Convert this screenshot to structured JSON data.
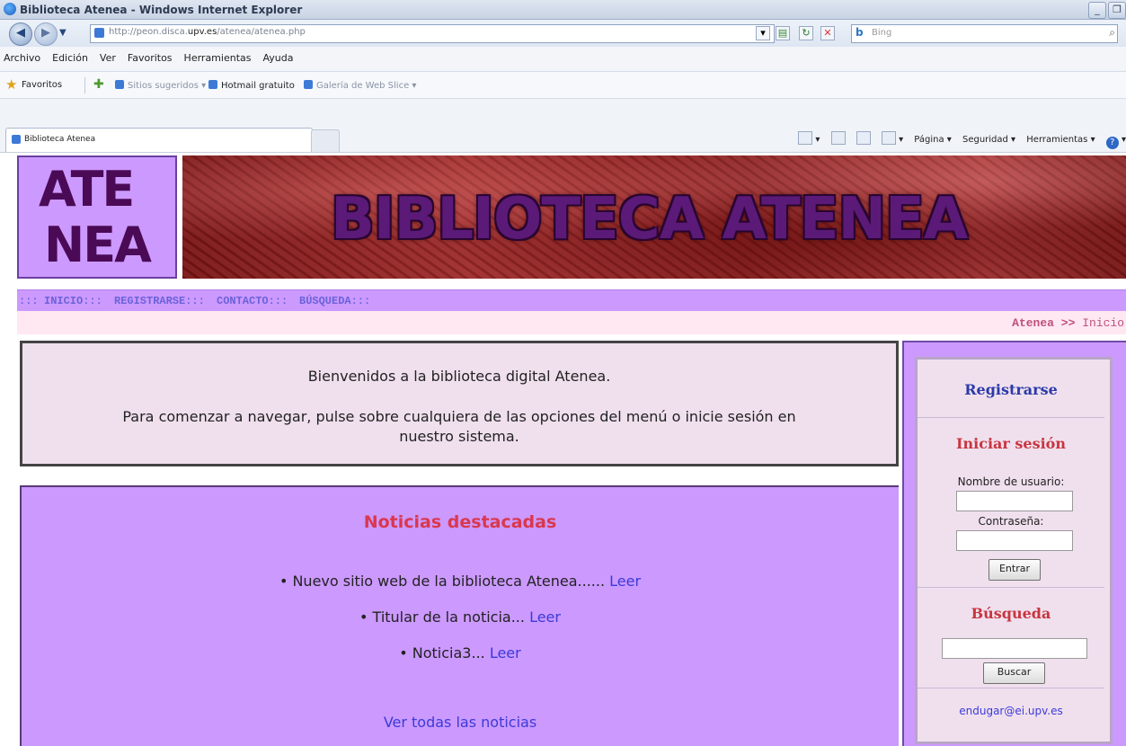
{
  "browser": {
    "window_title": "Biblioteca Atenea - Windows Internet Explorer",
    "url_prefix": "http://",
    "url_host_dim": "peon.disca.",
    "url_host": "upv.es",
    "url_path": "/atenea/atenea.php",
    "search_placeholder": "Bing",
    "menu": [
      "Archivo",
      "Edición",
      "Ver",
      "Favoritos",
      "Herramientas",
      "Ayuda"
    ],
    "favorites_label": "Favoritos",
    "favorites_items": [
      "Sitios sugeridos ▾",
      "Hotmail gratuito",
      "Galería de Web Slice ▾"
    ],
    "tab_label": "Biblioteca Atenea",
    "commands": [
      "Página ▾",
      "Seguridad ▾",
      "Herramientas ▾"
    ]
  },
  "header": {
    "logo_line1": "ATE",
    "logo_line2": "NEA",
    "banner_title": "BIBLIOTECA ATENEA"
  },
  "nav": {
    "prefix": ":::",
    "items": [
      "INICIO:::",
      "REGISTRARSE:::",
      "CONTACTO:::",
      "BÚSQUEDA:::"
    ]
  },
  "breadcrumb": {
    "root": "Atenea",
    "sep": ">>",
    "current": "Inicio"
  },
  "welcome": {
    "line1": "Bienvenidos a la biblioteca digital Atenea.",
    "line2": "Para comenzar a navegar, pulse sobre cualquiera de las opciones del menú o inicie sesión en",
    "line3": "nuestro sistema."
  },
  "news": {
    "title": "Noticias destacadas",
    "items": [
      {
        "text": "• Nuevo sitio web de la biblioteca Atenea......",
        "link": "Leer"
      },
      {
        "text": "• Titular de la noticia...",
        "link": "Leer"
      },
      {
        "text": "• Noticia3...",
        "link": "Leer"
      }
    ],
    "see_all": "Ver todas las noticias"
  },
  "sidebar": {
    "register": "Registrarse",
    "login_title": "Iniciar sesión",
    "username_label": "Nombre de usuario:",
    "password_label": "Contraseña:",
    "login_button": "Entrar",
    "search_title": "Búsqueda",
    "search_button": "Buscar",
    "email": "endugar@ei.upv.es"
  },
  "colors": {
    "lilac": "#cc99ff",
    "pink_panel": "#f0e0ee",
    "link": "#3b3ad6",
    "heading_red": "#d9384f"
  }
}
